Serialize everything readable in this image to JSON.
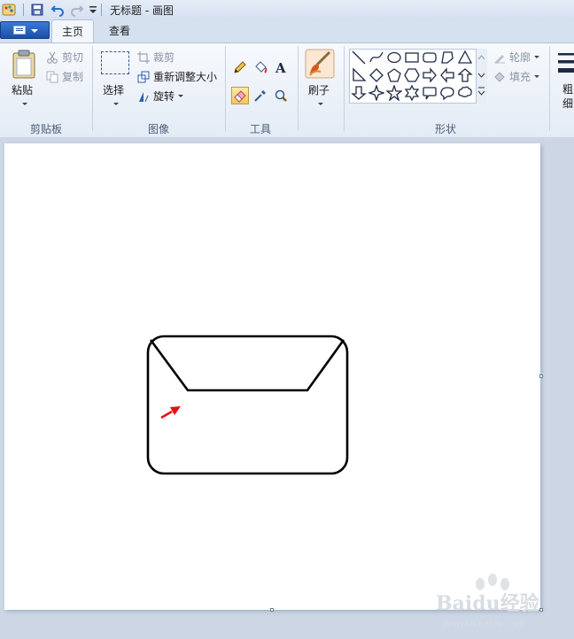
{
  "window": {
    "title": "无标题 - 画图"
  },
  "tabs": {
    "home": "主页",
    "view": "查看"
  },
  "clipboard": {
    "paste": "粘贴",
    "cut": "剪切",
    "copy": "复制",
    "label": "剪贴板"
  },
  "image": {
    "select": "选择",
    "crop": "裁剪",
    "resize": "重新调整大小",
    "rotate": "旋转",
    "label": "图像"
  },
  "tools": {
    "label": "工具",
    "selected": "eraser"
  },
  "brushes": {
    "label": "刷子"
  },
  "shapes": {
    "label": "形状",
    "outline": "轮廓",
    "fill": "填充",
    "icons": [
      "line",
      "curve",
      "oval",
      "rectangle",
      "rounded-rectangle",
      "polygon",
      "triangle",
      "right-triangle",
      "diamond",
      "pentagon",
      "hexagon",
      "right-arrow",
      "left-arrow",
      "up-arrow",
      "down-arrow",
      "four-point-star",
      "five-point-star",
      "six-point-star",
      "rounded-callout",
      "oval-callout",
      "cloud-callout"
    ]
  },
  "size": {
    "label": "粗细"
  },
  "watermark": {
    "logo": "Baidu经验",
    "url": "jingyan.baidu.com"
  },
  "colors": {
    "accent": "#1b4ea6",
    "arrow": "#e81010",
    "stroke": "#000000"
  }
}
